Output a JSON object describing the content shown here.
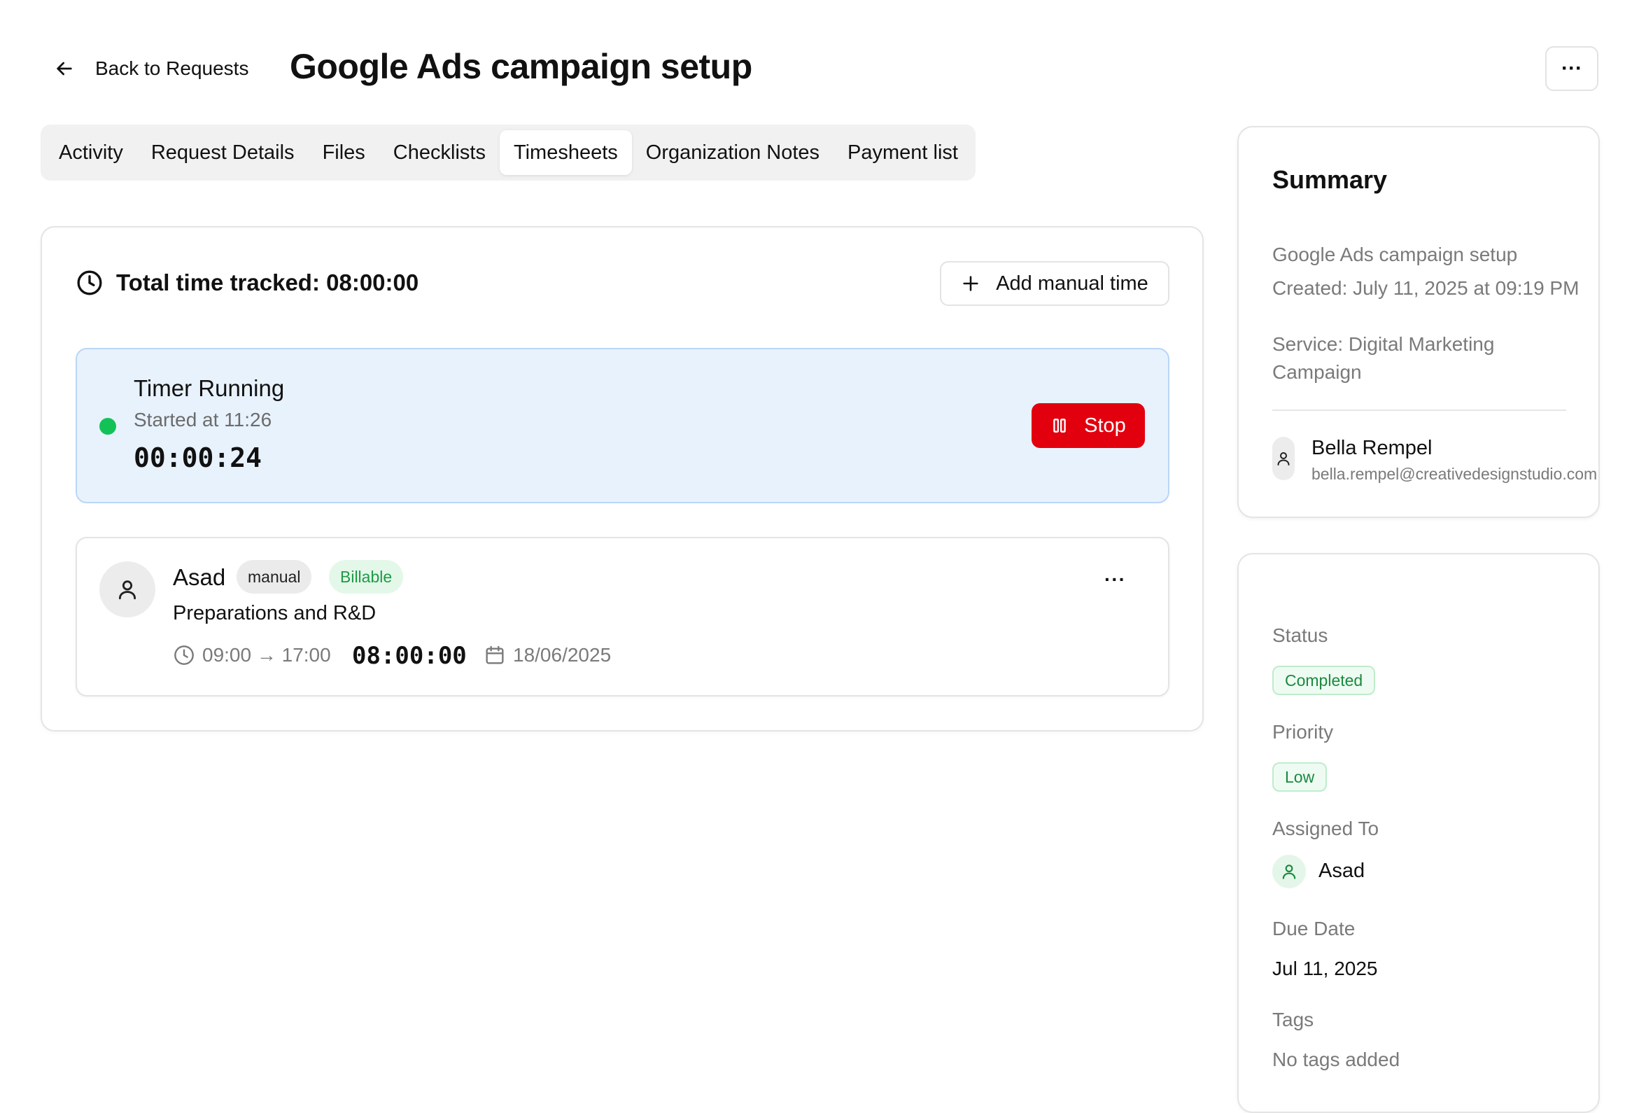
{
  "header": {
    "back_label": "Back to Requests",
    "title": "Google Ads campaign setup",
    "more_label": "···"
  },
  "tabs": [
    {
      "label": "Activity",
      "active": false
    },
    {
      "label": "Request Details",
      "active": false
    },
    {
      "label": "Files",
      "active": false
    },
    {
      "label": "Checklists",
      "active": false
    },
    {
      "label": "Timesheets",
      "active": true
    },
    {
      "label": "Organization Notes",
      "active": false
    },
    {
      "label": "Payment list",
      "active": false
    }
  ],
  "timesheets": {
    "total_label": "Total time tracked: 08:00:00",
    "add_manual_label": "Add manual time",
    "timer": {
      "title": "Timer Running",
      "started": "Started at 11:26",
      "elapsed": "00:00:24",
      "stop_label": "Stop"
    },
    "entries": [
      {
        "name": "Asad",
        "type_badge": "manual",
        "billing_badge": "Billable",
        "description": "Preparations and R&D",
        "time_range": "09:00 → 17:00",
        "duration": "08:00:00",
        "date": "18/06/2025",
        "more_label": "···"
      }
    ]
  },
  "summary": {
    "title": "Summary",
    "request_name": "Google Ads campaign setup",
    "created": "Created: July 11, 2025 at 09:19 PM",
    "service": "Service: Digital Marketing Campaign",
    "client_name": "Bella Rempel",
    "client_email": "bella.rempel@creativedesignstudio.com"
  },
  "details": {
    "status_label": "Status",
    "status_value": "Completed",
    "priority_label": "Priority",
    "priority_value": "Low",
    "assigned_label": "Assigned To",
    "assigned_value": "Asad",
    "due_label": "Due Date",
    "due_value": "Jul 11, 2025",
    "tags_label": "Tags",
    "tags_value": "No tags added"
  },
  "colors": {
    "stop_red": "#e2000f",
    "running_dot": "#12c257",
    "timer_bg": "#e8f2fd",
    "billable_green": "#1f9a46"
  }
}
